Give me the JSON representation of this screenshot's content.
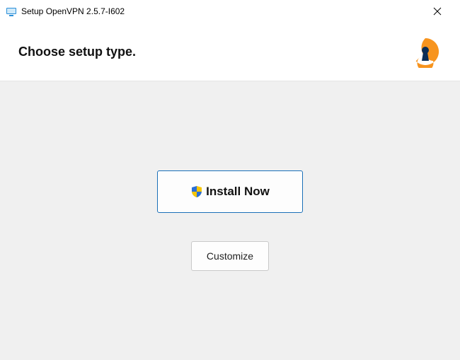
{
  "titlebar": {
    "title": "Setup OpenVPN 2.5.7-I602"
  },
  "header": {
    "heading": "Choose setup type."
  },
  "buttons": {
    "install_label": "Install Now",
    "customize_label": "Customize"
  }
}
